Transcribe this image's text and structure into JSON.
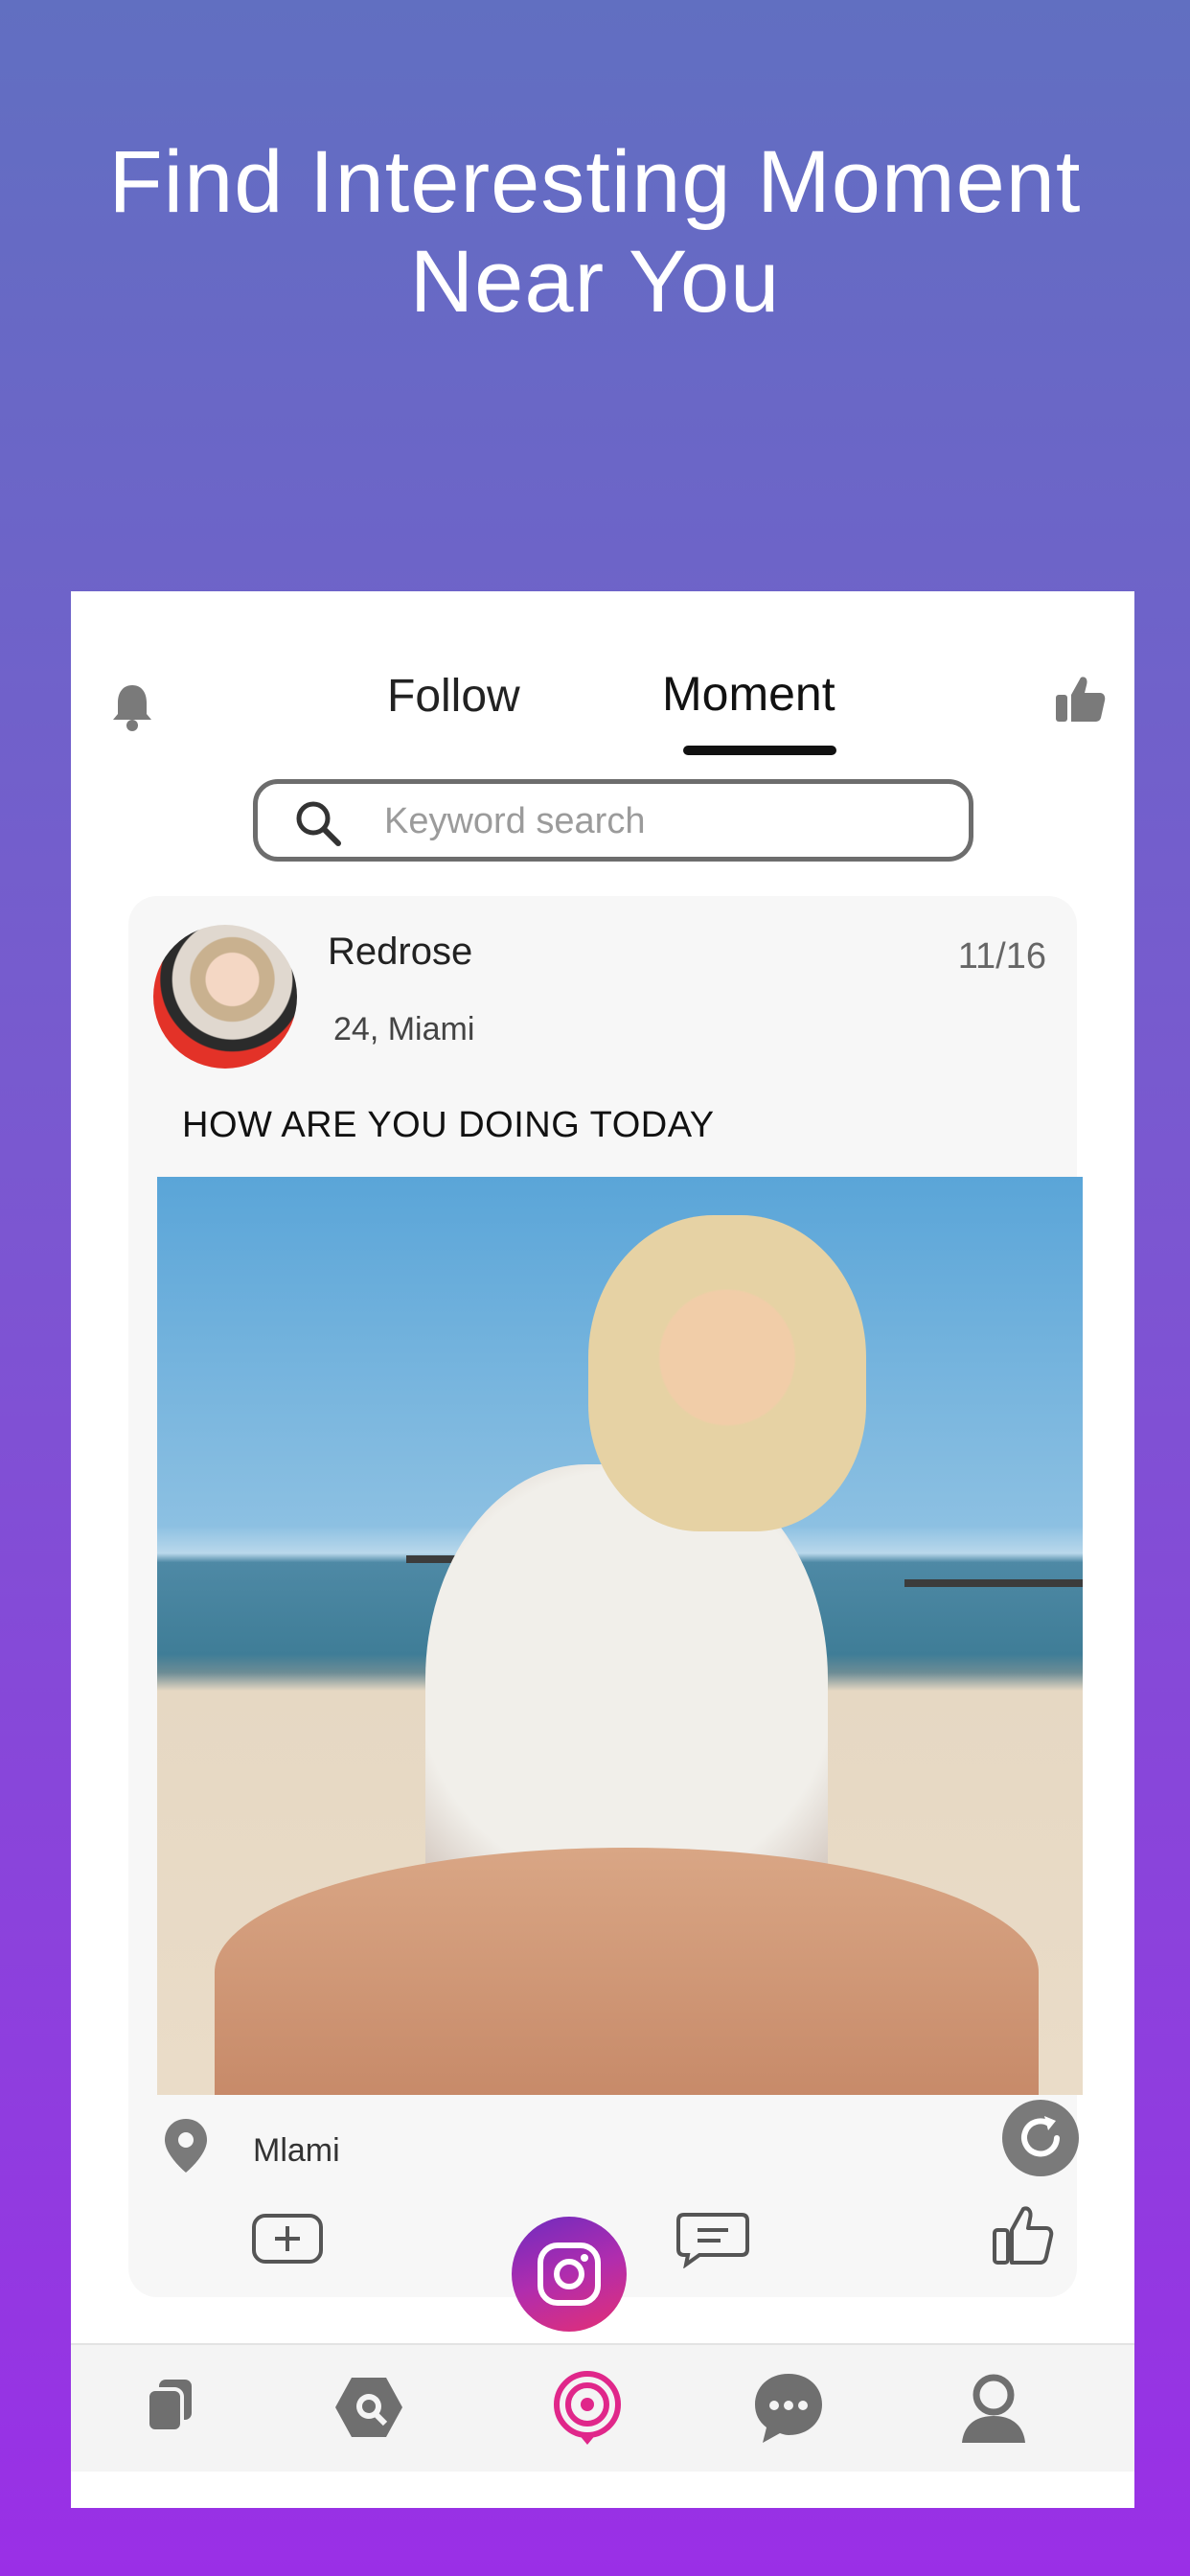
{
  "headline": {
    "line1": "Find Interesting Moment",
    "line2": "Near You"
  },
  "header": {
    "tabs": [
      {
        "label": "Follow"
      },
      {
        "label": "Moment"
      }
    ],
    "active_tab": "Moment"
  },
  "search": {
    "placeholder": "Keyword search",
    "value": ""
  },
  "post": {
    "username": "Redrose",
    "meta": "24, Miami",
    "date": "11/16",
    "text": "HOW ARE YOU DOING TODAY",
    "location": "Mlami"
  },
  "nav": {
    "items": [
      {
        "icon": "cards-icon"
      },
      {
        "icon": "explore-icon"
      },
      {
        "icon": "moments-icon",
        "active": true
      },
      {
        "icon": "chat-icon"
      },
      {
        "icon": "profile-icon"
      }
    ]
  },
  "colors": {
    "gradient_top": "#616fc1",
    "gradient_bottom": "#9a2fe6",
    "accent_pink": "#e0278a",
    "icon_gray": "#6f6f6f"
  }
}
